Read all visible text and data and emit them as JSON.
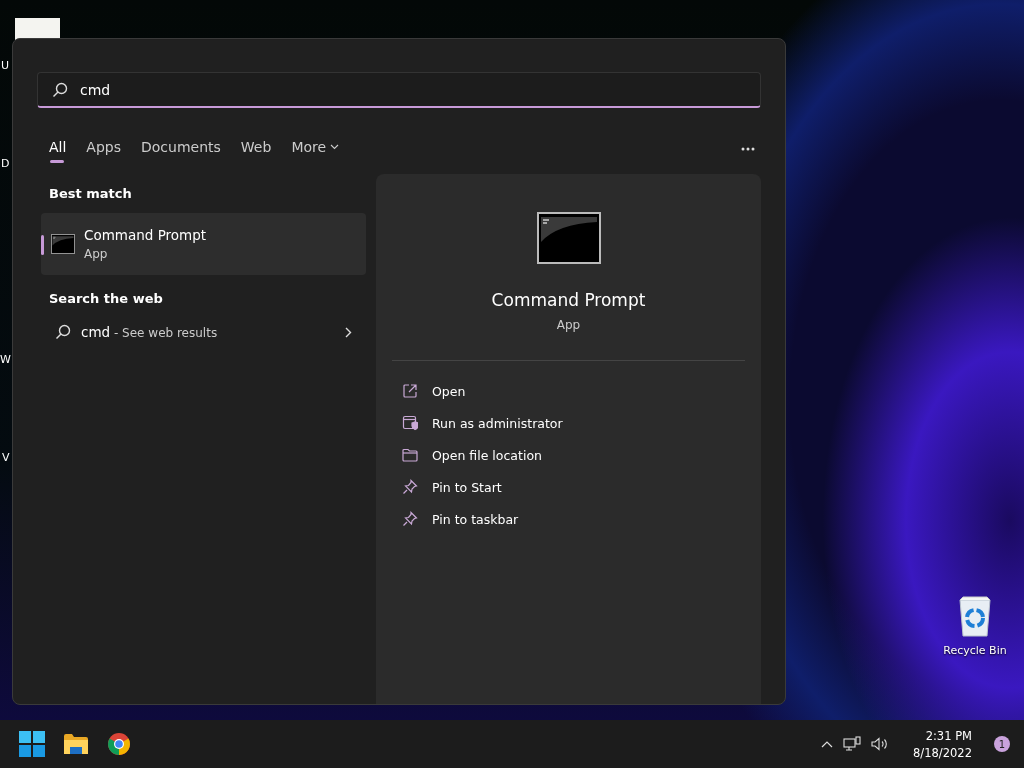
{
  "desktop_icons": [
    {
      "label": "U",
      "kind": "photo"
    },
    {
      "label": "D",
      "kind": "plain"
    },
    {
      "label": "W",
      "kind": "plain"
    },
    {
      "label": "V",
      "kind": "plain"
    },
    {
      "label": "Recycle Bin",
      "kind": "bin"
    }
  ],
  "search": {
    "value": "cmd"
  },
  "tabs": [
    {
      "label": "All",
      "selected": true,
      "kind": "plain"
    },
    {
      "label": "Apps",
      "selected": false,
      "kind": "plain"
    },
    {
      "label": "Documents",
      "selected": false,
      "kind": "plain"
    },
    {
      "label": "Web",
      "selected": false,
      "kind": "plain"
    },
    {
      "label": "More",
      "selected": false,
      "kind": "dropdown"
    }
  ],
  "best_match": {
    "heading": "Best match",
    "items": [
      {
        "title": "Command Prompt",
        "subtitle": "App",
        "selected": true
      }
    ]
  },
  "web_search": {
    "heading": "Search the web",
    "items": [
      {
        "query": "cmd",
        "suffix": " - See web results"
      }
    ]
  },
  "detail": {
    "title": "Command Prompt",
    "subtitle": "App",
    "actions": [
      {
        "label": "Open",
        "kind": "open"
      },
      {
        "label": "Run as administrator",
        "kind": "admin"
      },
      {
        "label": "Open file location",
        "kind": "folder"
      },
      {
        "label": "Pin to Start",
        "kind": "pin"
      },
      {
        "label": "Pin to taskbar",
        "kind": "pin"
      }
    ]
  },
  "taskbar": {
    "time": "2:31 PM",
    "date": "8/18/2022",
    "notification_count": "1"
  }
}
